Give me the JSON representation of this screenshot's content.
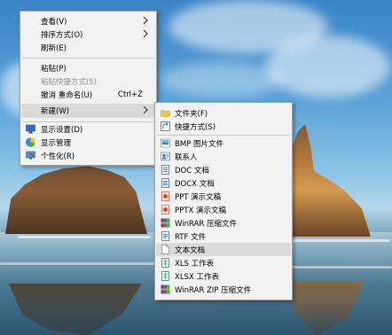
{
  "context_menu": {
    "items": [
      {
        "label": "查看(V)",
        "has_submenu": true
      },
      {
        "label": "排序方式(O)",
        "has_submenu": true
      },
      {
        "label": "刷新(E)"
      },
      {
        "label": "粘贴(P)"
      },
      {
        "label": "粘贴快捷方式(S)",
        "disabled": true
      },
      {
        "label": "撤消 重命名(U)",
        "shortcut": "Ctrl+Z"
      },
      {
        "label": "新建(W)",
        "has_submenu": true,
        "highlighted": true
      },
      {
        "label": "显示设置(D)",
        "icon": "display-settings-icon"
      },
      {
        "label": "显示管理",
        "icon": "display-manager-icon"
      },
      {
        "label": "个性化(R)",
        "icon": "personalize-icon"
      }
    ]
  },
  "new_submenu": {
    "items": [
      {
        "label": "文件夹(F)",
        "icon": "folder-icon"
      },
      {
        "label": "快捷方式(S)",
        "icon": "shortcut-icon"
      },
      {
        "label": "BMP 图片文件",
        "icon": "bmp-file-icon"
      },
      {
        "label": "联系人",
        "icon": "contact-icon"
      },
      {
        "label": "DOC 文档",
        "icon": "doc-file-icon"
      },
      {
        "label": "DOCX 文档",
        "icon": "docx-file-icon"
      },
      {
        "label": "PPT 演示文稿",
        "icon": "ppt-file-icon"
      },
      {
        "label": "PPTX 演示文稿",
        "icon": "pptx-file-icon"
      },
      {
        "label": "WinRAR 压缩文件",
        "icon": "winrar-icon"
      },
      {
        "label": "RTF 文件",
        "icon": "rtf-file-icon"
      },
      {
        "label": "文本文档",
        "icon": "text-file-icon",
        "highlighted": true
      },
      {
        "label": "XLS 工作表",
        "icon": "xls-file-icon"
      },
      {
        "label": "XLSX 工作表",
        "icon": "xlsx-file-icon"
      },
      {
        "label": "WinRAR ZIP 压缩文件",
        "icon": "winrar-zip-icon"
      }
    ]
  },
  "colors": {
    "menu_background": "#f2f2f2",
    "highlight": "#d9d9d9",
    "disabled_text": "#8d8d8d"
  }
}
